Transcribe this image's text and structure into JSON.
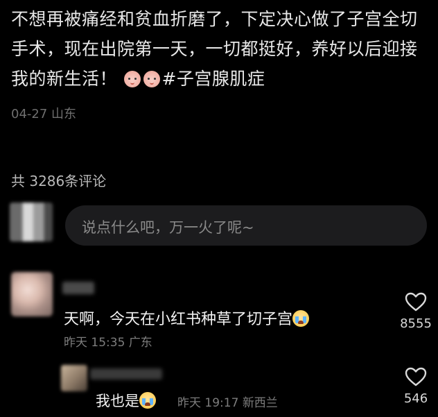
{
  "post": {
    "text": "不想再被痛经和贫血折磨了，下定决心做了子宫全切手术，现在出院第一天，一切都挺好，养好以后迎接我的新生活！",
    "emojis": [
      "smile-emoji",
      "smile-emoji"
    ],
    "hashtag": "#子宫腺肌症",
    "date": "04-27",
    "location": "山东"
  },
  "comments_header": {
    "label": "共 3286条评论"
  },
  "comment_input": {
    "placeholder": "说点什么吧，万一火了呢~"
  },
  "comments": [
    {
      "text": "天啊，今天在小红书种草了切子宫",
      "emoji": "crying-emoji",
      "time": "昨天 15:35",
      "location": "广东",
      "likes": "8555"
    },
    {
      "text": "我也是",
      "emoji": "crying-emoji",
      "time": "昨天 19:17",
      "location": "新西兰",
      "likes": "546"
    }
  ],
  "icons": {
    "like": "heart-outline-icon"
  },
  "colors": {
    "background": "#000000",
    "input_background": "#1c1c1e",
    "meta_text": "#7d7d7d"
  }
}
